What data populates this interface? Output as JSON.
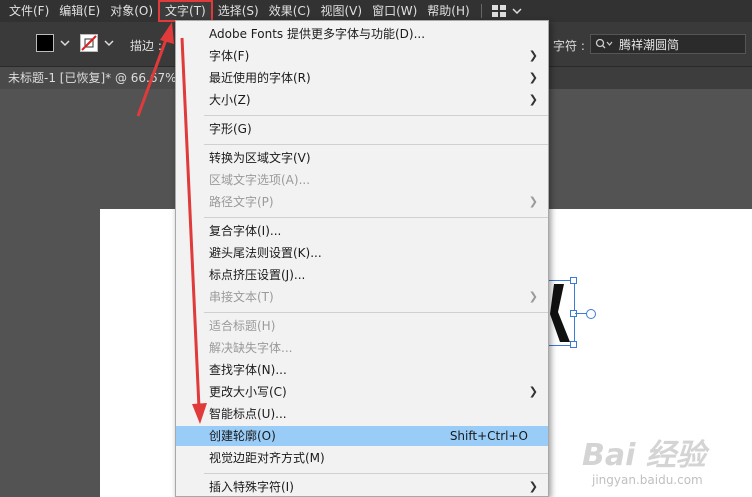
{
  "menubar": {
    "items": [
      "文件(F)",
      "编辑(E)",
      "对象(O)",
      "文字(T)",
      "选择(S)",
      "效果(C)",
      "视图(V)",
      "窗口(W)",
      "帮助(H)"
    ],
    "active_index": 3,
    "workspace_icon": "grid-icon"
  },
  "toolbar": {
    "stroke_label": "描边 :",
    "char_label": "字符 :",
    "font_value": "腾祥潮圆简",
    "fill_color": "#000000"
  },
  "document": {
    "tab_title": "未标题-1 [已恢复]* @ 66.67%"
  },
  "type_menu": {
    "items": [
      {
        "label": "Adobe Fonts 提供更多字体与功能(D)...",
        "shortcut": "",
        "submenu": false,
        "disabled": false,
        "highlighted": false
      },
      {
        "label": "字体(F)",
        "shortcut": "",
        "submenu": true,
        "disabled": false,
        "highlighted": false
      },
      {
        "label": "最近使用的字体(R)",
        "shortcut": "",
        "submenu": true,
        "disabled": false,
        "highlighted": false
      },
      {
        "label": "大小(Z)",
        "shortcut": "",
        "submenu": true,
        "disabled": false,
        "highlighted": false
      },
      {
        "label": "字形(G)",
        "shortcut": "",
        "submenu": false,
        "disabled": false,
        "highlighted": false
      },
      {
        "label": "转换为区域文字(V)",
        "shortcut": "",
        "submenu": false,
        "disabled": false,
        "highlighted": false
      },
      {
        "label": "区域文字选项(A)...",
        "shortcut": "",
        "submenu": false,
        "disabled": true,
        "highlighted": false
      },
      {
        "label": "路径文字(P)",
        "shortcut": "",
        "submenu": true,
        "disabled": true,
        "highlighted": false
      },
      {
        "label": "复合字体(I)...",
        "shortcut": "",
        "submenu": false,
        "disabled": false,
        "highlighted": false
      },
      {
        "label": "避头尾法则设置(K)...",
        "shortcut": "",
        "submenu": false,
        "disabled": false,
        "highlighted": false
      },
      {
        "label": "标点挤压设置(J)...",
        "shortcut": "",
        "submenu": false,
        "disabled": false,
        "highlighted": false
      },
      {
        "label": "串接文本(T)",
        "shortcut": "",
        "submenu": true,
        "disabled": true,
        "highlighted": false
      },
      {
        "label": "适合标题(H)",
        "shortcut": "",
        "submenu": false,
        "disabled": true,
        "highlighted": false
      },
      {
        "label": "解决缺失字体...",
        "shortcut": "",
        "submenu": false,
        "disabled": true,
        "highlighted": false
      },
      {
        "label": "查找字体(N)...",
        "shortcut": "",
        "submenu": false,
        "disabled": false,
        "highlighted": false
      },
      {
        "label": "更改大小写(C)",
        "shortcut": "",
        "submenu": true,
        "disabled": false,
        "highlighted": false
      },
      {
        "label": "智能标点(U)...",
        "shortcut": "",
        "submenu": false,
        "disabled": false,
        "highlighted": false
      },
      {
        "label": "创建轮廓(O)",
        "shortcut": "Shift+Ctrl+O",
        "submenu": false,
        "disabled": false,
        "highlighted": true
      },
      {
        "label": "视觉边距对齐方式(M)",
        "shortcut": "",
        "submenu": false,
        "disabled": false,
        "highlighted": false
      },
      {
        "label": "插入特殊字符(I)",
        "shortcut": "",
        "submenu": true,
        "disabled": false,
        "highlighted": false
      }
    ]
  },
  "watermark": {
    "main": "Bai 经验",
    "sub": "jingyan.baidu.com"
  },
  "colors": {
    "highlight": "#99ccf7",
    "annotation_red": "#e03a3a",
    "selection_blue": "#3a7bd5"
  }
}
